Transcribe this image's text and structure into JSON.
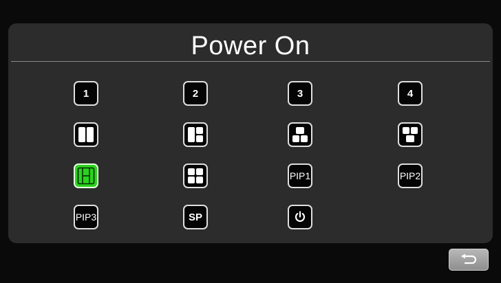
{
  "title": "Power On",
  "accent_color": "#2ad31e",
  "buttons": {
    "ch1": "1",
    "ch2": "2",
    "ch3": "3",
    "ch4": "4",
    "pip1": "PIP1",
    "pip2": "PIP2",
    "pip3": "PIP3",
    "sp": "SP"
  },
  "selected_layout": "split-h-layout",
  "icons": {
    "split2": "split-2-icon",
    "split3a": "split-3-left-icon",
    "split3b": "split-3-bottom-icon",
    "split3c": "split-3-top-icon",
    "splitH": "split-h-icon",
    "quad": "quad-split-icon",
    "power": "power-icon",
    "back": "back-arrow-icon"
  }
}
